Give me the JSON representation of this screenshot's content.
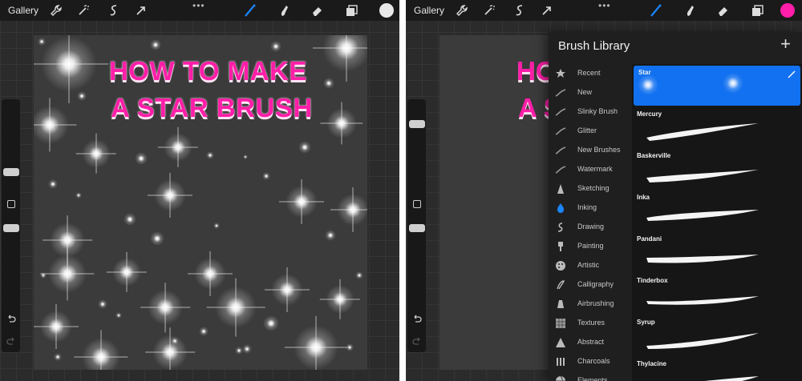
{
  "left": {
    "gallery_label": "Gallery",
    "color": "#e8e8e8",
    "title_lines": [
      "HOW TO MAKE",
      "A STAR BRUSH"
    ]
  },
  "right": {
    "gallery_label": "Gallery",
    "color": "#ff2bb5",
    "title_lines": [
      "HO",
      "A S"
    ],
    "library": {
      "title": "Brush Library",
      "add_label": "+",
      "categories": [
        {
          "label": "Recent",
          "icon": "star-icon"
        },
        {
          "label": "New",
          "icon": "stroke-icon"
        },
        {
          "label": "Slinky Brush",
          "icon": "stroke-icon"
        },
        {
          "label": "Glitter",
          "icon": "stroke-icon"
        },
        {
          "label": "New Brushes",
          "icon": "stroke-icon"
        },
        {
          "label": "Watermark",
          "icon": "stroke-icon"
        },
        {
          "label": "Sketching",
          "icon": "pencil-tip-icon"
        },
        {
          "label": "Inking",
          "icon": "ink-drop-icon"
        },
        {
          "label": "Drawing",
          "icon": "swirl-icon"
        },
        {
          "label": "Painting",
          "icon": "paint-brush-icon"
        },
        {
          "label": "Artistic",
          "icon": "palette-icon"
        },
        {
          "label": "Calligraphy",
          "icon": "calligraphy-icon"
        },
        {
          "label": "Airbrushing",
          "icon": "airbrush-icon"
        },
        {
          "label": "Textures",
          "icon": "texture-icon"
        },
        {
          "label": "Abstract",
          "icon": "triangle-icon"
        },
        {
          "label": "Charcoals",
          "icon": "charcoal-icon"
        },
        {
          "label": "Elements",
          "icon": "globe-icon"
        }
      ],
      "brushes": [
        "Star",
        "Mercury",
        "Baskerville",
        "Inka",
        "Pandani",
        "Tinderbox",
        "Syrup",
        "Thylacine"
      ],
      "selected_brush": "Star"
    }
  },
  "accent": "#1271f0"
}
